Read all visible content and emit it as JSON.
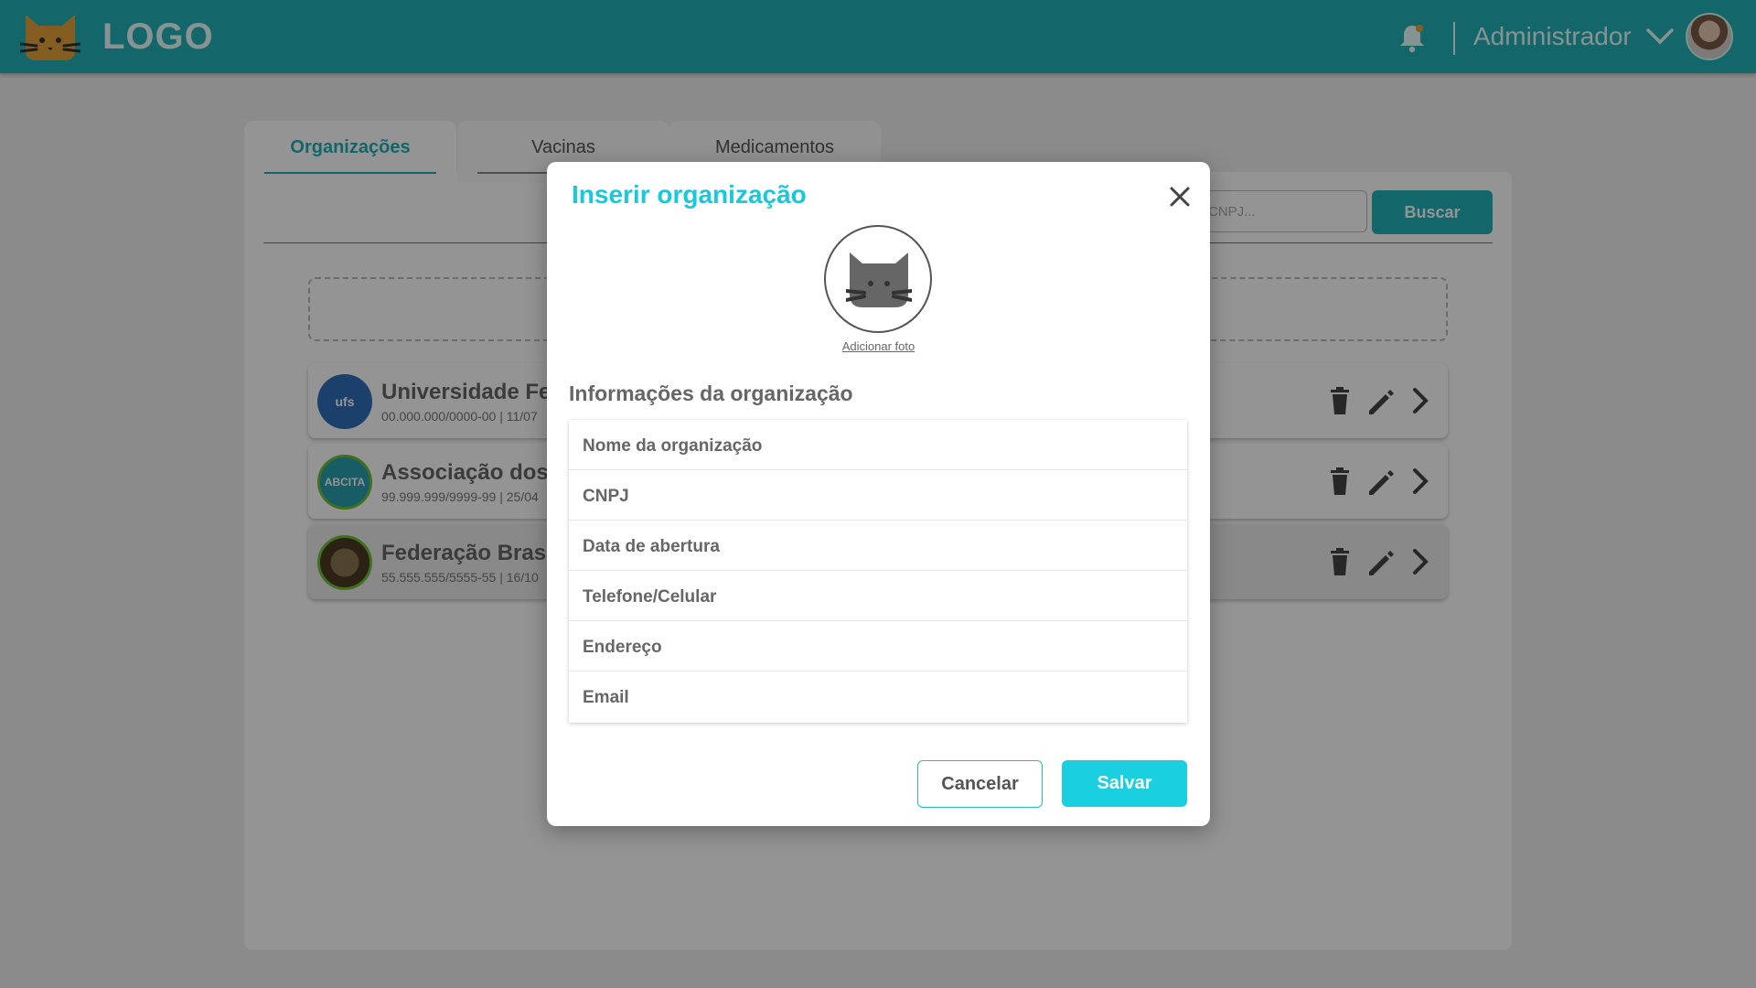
{
  "header": {
    "logo_text": "LOGO",
    "user_name": "Administrador"
  },
  "tabs": [
    {
      "label": "Organizações",
      "active": true
    },
    {
      "label": "Vacinas",
      "active": false
    },
    {
      "label": "Medicamentos",
      "active": false
    }
  ],
  "search": {
    "placeholder": "CNPJ...",
    "button_label": "Buscar"
  },
  "organizations": [
    {
      "name": "Universidade Fec",
      "details": "00.000.000/0000-00 | 11/07",
      "logo_text": "ufs",
      "logo_color": "#2e6fb8"
    },
    {
      "name": "Associação dos I",
      "details": "99.999.999/9999-99 | 25/04",
      "logo_text": "ABCITA",
      "logo_color": "#2a9fb0"
    },
    {
      "name": "Federação Brasil",
      "details": "55.555.555/5555-55 | 16/10",
      "logo_text": "",
      "logo_color": "#6b5a3c"
    }
  ],
  "modal": {
    "title": "Inserir organização",
    "add_photo": "Adicionar foto",
    "section_title": "Informações da organização",
    "fields": [
      "Nome da organização",
      "CNPJ",
      "Data de abertura",
      "Telefone/Celular",
      "Endereço",
      "Email"
    ],
    "cancel_label": "Cancelar",
    "save_label": "Salvar"
  },
  "colors": {
    "header": "#21b2b7",
    "accent": "#19cfe0",
    "overlay": "rgba(0,0,0,0.42)"
  }
}
